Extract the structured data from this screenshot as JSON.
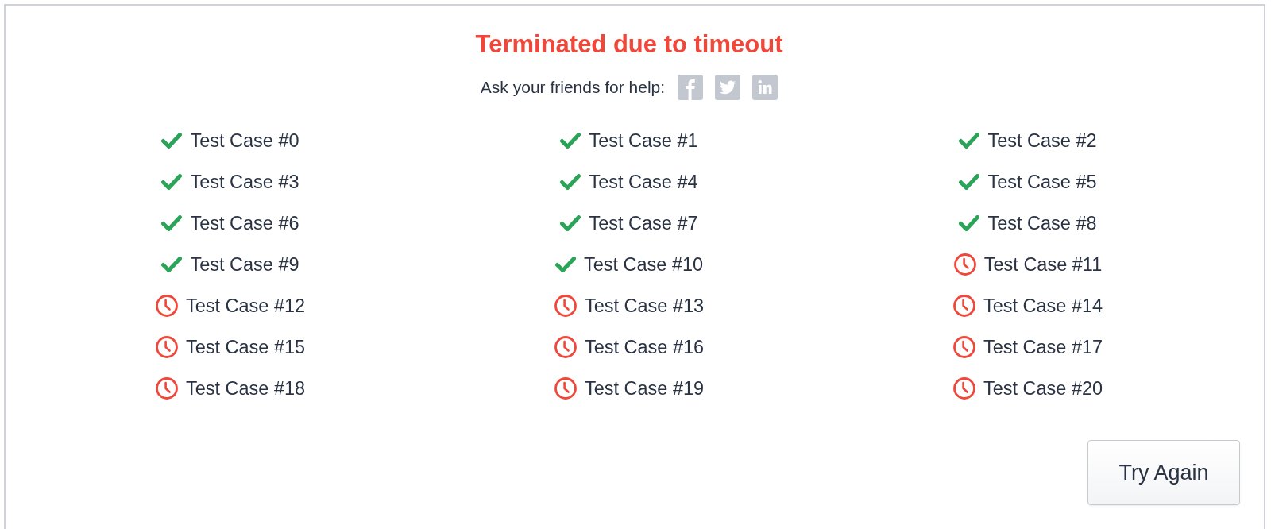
{
  "result": {
    "title": "Terminated due to timeout",
    "share_prompt": "Ask your friends for help:",
    "share_buttons": [
      {
        "kind": "facebook"
      },
      {
        "kind": "twitter"
      },
      {
        "kind": "linkedin"
      }
    ]
  },
  "test_cases": [
    {
      "label": "Test Case #0",
      "kind": "passed"
    },
    {
      "label": "Test Case #1",
      "kind": "passed"
    },
    {
      "label": "Test Case #2",
      "kind": "passed"
    },
    {
      "label": "Test Case #3",
      "kind": "passed"
    },
    {
      "label": "Test Case #4",
      "kind": "passed"
    },
    {
      "label": "Test Case #5",
      "kind": "passed"
    },
    {
      "label": "Test Case #6",
      "kind": "passed"
    },
    {
      "label": "Test Case #7",
      "kind": "passed"
    },
    {
      "label": "Test Case #8",
      "kind": "passed"
    },
    {
      "label": "Test Case #9",
      "kind": "passed"
    },
    {
      "label": "Test Case #10",
      "kind": "passed"
    },
    {
      "label": "Test Case #11",
      "kind": "timeout"
    },
    {
      "label": "Test Case #12",
      "kind": "timeout"
    },
    {
      "label": "Test Case #13",
      "kind": "timeout"
    },
    {
      "label": "Test Case #14",
      "kind": "timeout"
    },
    {
      "label": "Test Case #15",
      "kind": "timeout"
    },
    {
      "label": "Test Case #16",
      "kind": "timeout"
    },
    {
      "label": "Test Case #17",
      "kind": "timeout"
    },
    {
      "label": "Test Case #18",
      "kind": "timeout"
    },
    {
      "label": "Test Case #19",
      "kind": "timeout"
    },
    {
      "label": "Test Case #20",
      "kind": "timeout"
    }
  ],
  "actions": {
    "retry_button": "Try Again"
  }
}
